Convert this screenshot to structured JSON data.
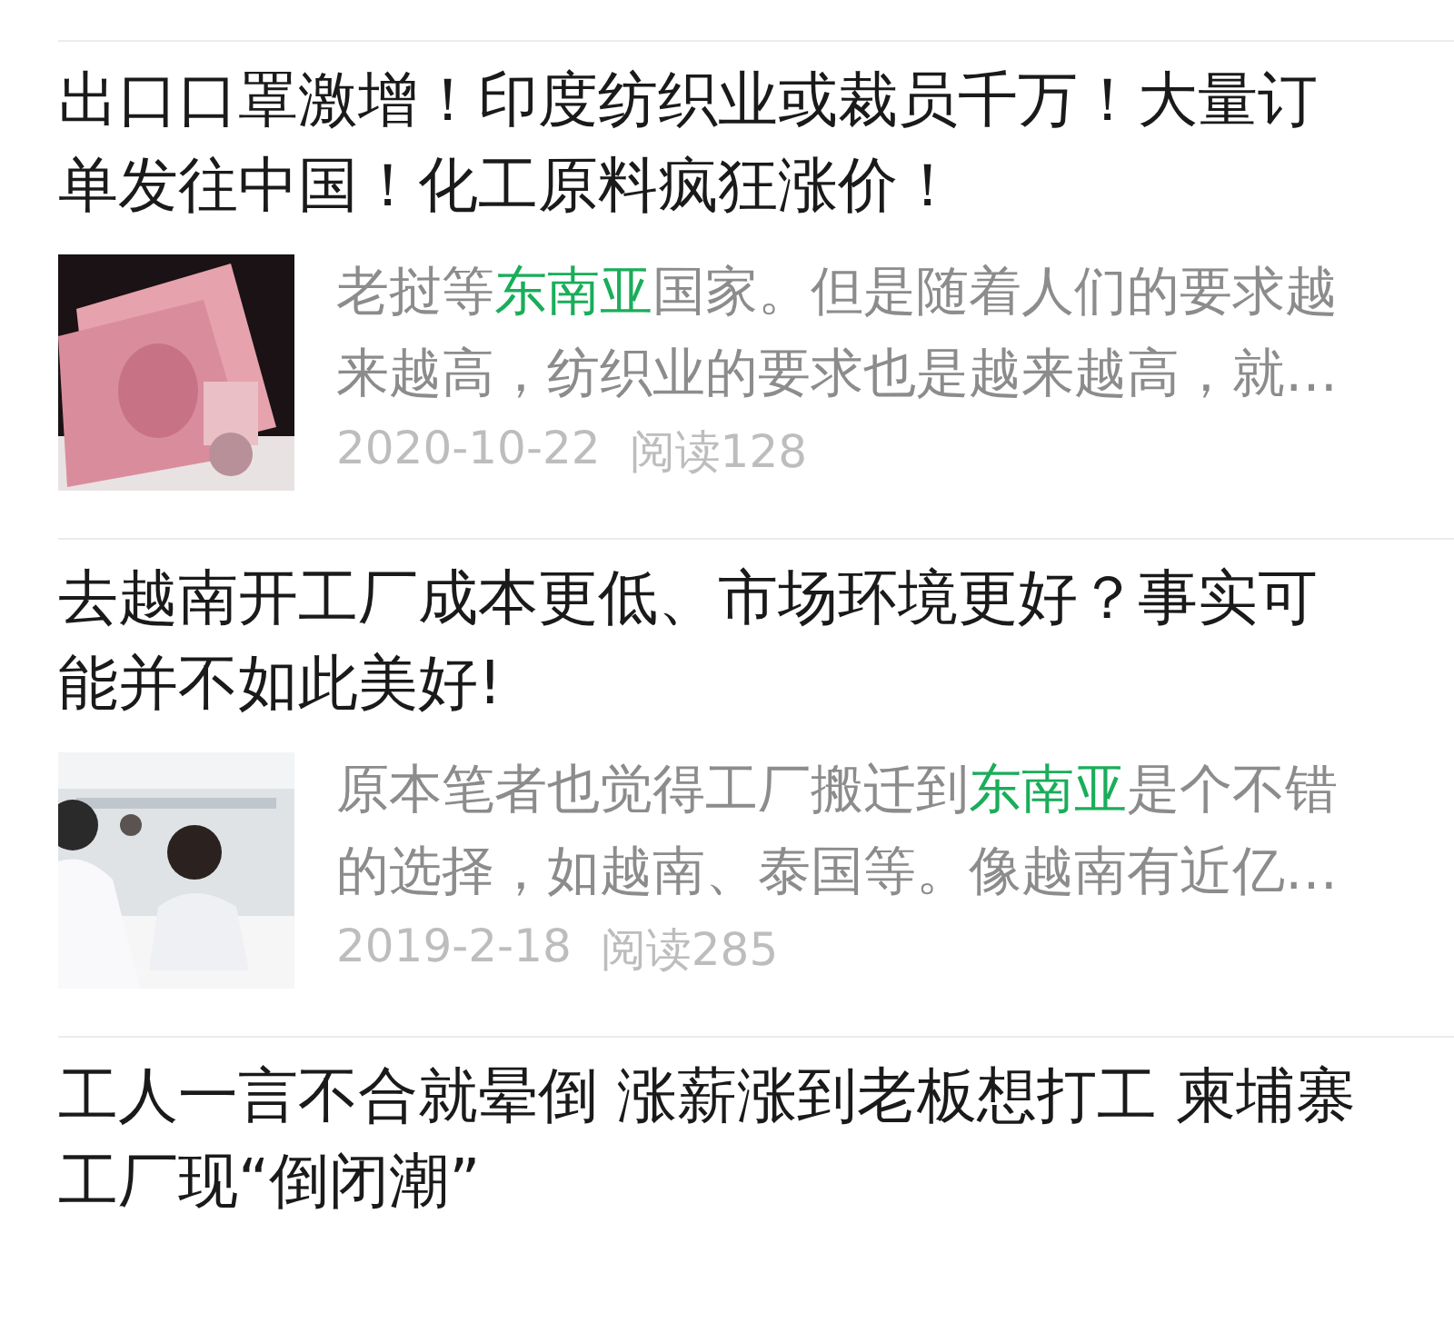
{
  "articles": [
    {
      "title": "出口口罩激增！印度纺织业或裁员千万！大量订单发往中国！化工原料疯狂涨价！",
      "snippet": {
        "before": "老挝等",
        "highlight": "东南亚",
        "after": "国家。但是随着人们的要求越来越高，纺织业的要求也是越来越高，就…"
      },
      "date": "2020-10-22",
      "reads": "阅读128"
    },
    {
      "title": "去越南开工厂成本更低、市场环境更好？事实可能并不如此美好!",
      "snippet": {
        "before": "原本笔者也觉得工厂搬迁到",
        "highlight": "东南亚",
        "after": "是个不错的选择，如越南、泰国等。像越南有近亿…"
      },
      "date": "2019-2-18",
      "reads": "阅读285"
    },
    {
      "title": "工人一言不合就晕倒 涨薪涨到老板想打工 柬埔寨工厂现“倒闭潮”"
    }
  ]
}
